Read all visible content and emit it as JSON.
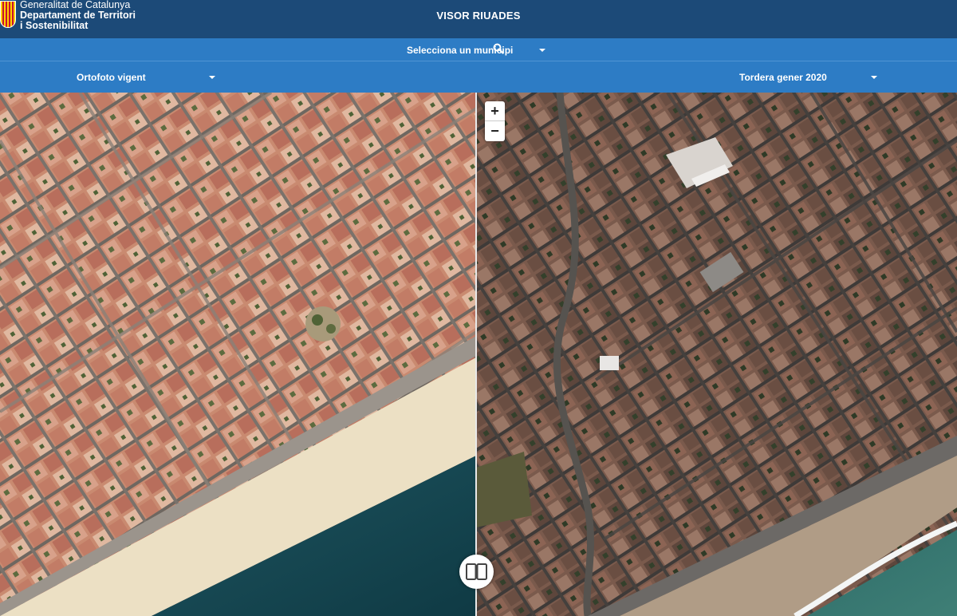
{
  "header": {
    "logo_line1": "Generalitat de Catalunya",
    "logo_line2": "Departament de Territori",
    "logo_line3": "i Sostenibilitat",
    "title": "VISOR RIUADES",
    "background": "#1c4a78"
  },
  "municipality": {
    "label": "Selecciona un municipi",
    "icon": "search-icon",
    "bar_color": "#2d7cc5"
  },
  "layers": {
    "left_label": "Ortofoto vigent",
    "right_label": "Tordera gener 2020"
  },
  "map": {
    "zoom_in": "+",
    "zoom_out": "−",
    "swipe_icon": "split-view-icon",
    "sea_color": "#12404a",
    "beach_color": "#ece0c4"
  }
}
